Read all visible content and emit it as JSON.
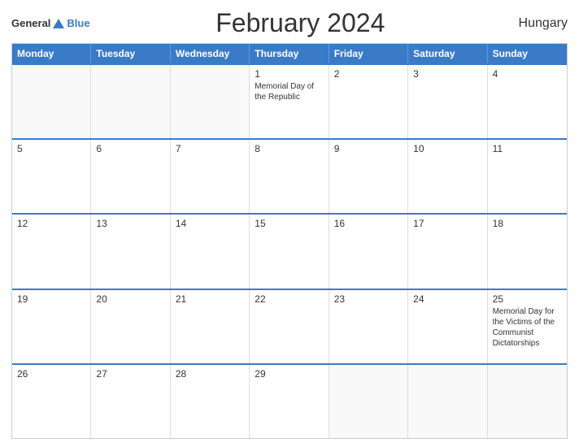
{
  "header": {
    "logo": {
      "general": "General",
      "blue": "Blue"
    },
    "title": "February 2024",
    "country": "Hungary"
  },
  "calendar": {
    "weekdays": [
      "Monday",
      "Tuesday",
      "Wednesday",
      "Thursday",
      "Friday",
      "Saturday",
      "Sunday"
    ],
    "weeks": [
      [
        {
          "day": "",
          "event": ""
        },
        {
          "day": "",
          "event": ""
        },
        {
          "day": "",
          "event": ""
        },
        {
          "day": "1",
          "event": "Memorial Day of the Republic"
        },
        {
          "day": "2",
          "event": ""
        },
        {
          "day": "3",
          "event": ""
        },
        {
          "day": "4",
          "event": ""
        }
      ],
      [
        {
          "day": "5",
          "event": ""
        },
        {
          "day": "6",
          "event": ""
        },
        {
          "day": "7",
          "event": ""
        },
        {
          "day": "8",
          "event": ""
        },
        {
          "day": "9",
          "event": ""
        },
        {
          "day": "10",
          "event": ""
        },
        {
          "day": "11",
          "event": ""
        }
      ],
      [
        {
          "day": "12",
          "event": ""
        },
        {
          "day": "13",
          "event": ""
        },
        {
          "day": "14",
          "event": ""
        },
        {
          "day": "15",
          "event": ""
        },
        {
          "day": "16",
          "event": ""
        },
        {
          "day": "17",
          "event": ""
        },
        {
          "day": "18",
          "event": ""
        }
      ],
      [
        {
          "day": "19",
          "event": ""
        },
        {
          "day": "20",
          "event": ""
        },
        {
          "day": "21",
          "event": ""
        },
        {
          "day": "22",
          "event": ""
        },
        {
          "day": "23",
          "event": ""
        },
        {
          "day": "24",
          "event": ""
        },
        {
          "day": "25",
          "event": "Memorial Day for the Victims of the Communist Dictatorships"
        }
      ],
      [
        {
          "day": "26",
          "event": ""
        },
        {
          "day": "27",
          "event": ""
        },
        {
          "day": "28",
          "event": ""
        },
        {
          "day": "29",
          "event": ""
        },
        {
          "day": "",
          "event": ""
        },
        {
          "day": "",
          "event": ""
        },
        {
          "day": "",
          "event": ""
        }
      ]
    ]
  }
}
